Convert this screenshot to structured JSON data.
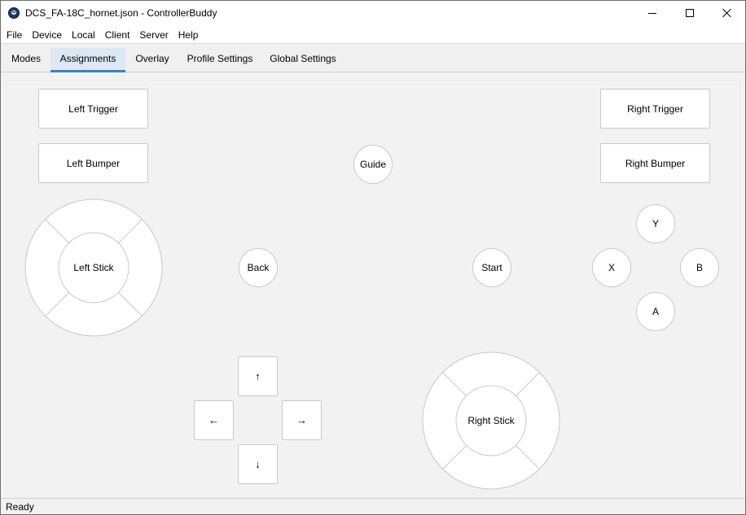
{
  "window": {
    "title": "DCS_FA-18C_hornet.json - ControllerBuddy",
    "app_icon": "controllerbuddy-icon"
  },
  "menu": {
    "items": [
      "File",
      "Device",
      "Local",
      "Client",
      "Server",
      "Help"
    ]
  },
  "tabs": {
    "items": [
      "Modes",
      "Assignments",
      "Overlay",
      "Profile Settings",
      "Global Settings"
    ],
    "active": "Assignments"
  },
  "controls": {
    "left_trigger": "Left Trigger",
    "left_bumper": "Left Bumper",
    "right_trigger": "Right Trigger",
    "right_bumper": "Right Bumper",
    "guide": "Guide",
    "back": "Back",
    "start": "Start",
    "y": "Y",
    "x": "X",
    "b": "B",
    "a": "A",
    "left_stick": "Left Stick",
    "right_stick": "Right Stick",
    "dpad_up": "↑",
    "dpad_left": "←",
    "dpad_right": "→",
    "dpad_down": "↓"
  },
  "status": {
    "text": "Ready"
  },
  "colors": {
    "tab_active_underline": "#3d82c6",
    "tab_active_bg": "#dde8f4",
    "button_border": "#c9c9c9"
  }
}
